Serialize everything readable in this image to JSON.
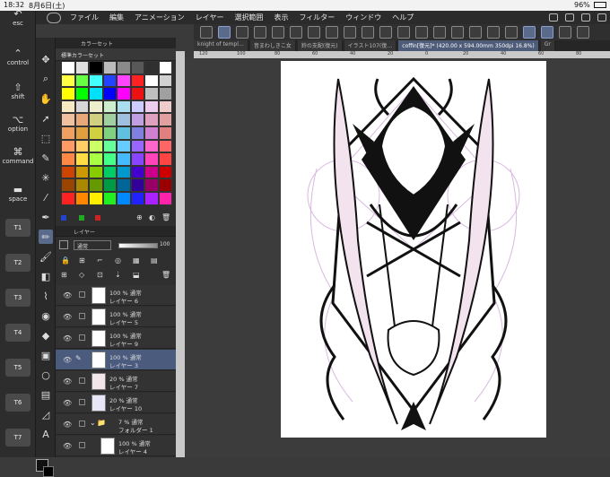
{
  "status": {
    "time": "18:32",
    "date": "8月6日(土)",
    "battery": "96%"
  },
  "menu": [
    "ファイル",
    "編集",
    "アニメーション",
    "レイヤー",
    "選択範囲",
    "表示",
    "フィルター",
    "ウィンドウ",
    "ヘルプ"
  ],
  "keys": {
    "esc": "esc",
    "control": "control",
    "shift": "shift",
    "option": "option",
    "command": "command",
    "space": "space",
    "t": [
      "T1",
      "T2",
      "T3",
      "T4",
      "T5",
      "T6",
      "T7"
    ]
  },
  "tabs": [
    "knight of templ…",
    "音まわしきこ女",
    "鈴の支配(復元)",
    "イラスト107(復…",
    "coffin[復元]* (420.00 x 594.00mm 350dpi 16.8%)",
    "Gr"
  ],
  "color_panel": {
    "title": "カラーセット",
    "set_name": "標準カラーセット",
    "swatches": [
      "#ffffff",
      "#e0e0e0",
      "#000000",
      "#bcbcbc",
      "#8a8a8a",
      "#585858",
      "#303030",
      "#ffffff",
      "#ffff44",
      "#66ff44",
      "#44ffff",
      "#2244ff",
      "#ff44ff",
      "#ff2222",
      "#ffffff",
      "#d0d0d0",
      "#ffff00",
      "#00ff00",
      "#00e0ff",
      "#0000ff",
      "#ff00ff",
      "#ee1111",
      "#c0c0c0",
      "#a0a0a0",
      "#f7e9c4",
      "#d7d7d7",
      "#eeeecc",
      "#cceecc",
      "#aaddee",
      "#ccccff",
      "#eeccee",
      "#eecccc",
      "#f0c0a0",
      "#e8a87a",
      "#d0d080",
      "#a0d0a0",
      "#a0c0e0",
      "#c0a0e0",
      "#e0a0c0",
      "#e0a0a0",
      "#f0a060",
      "#e0a040",
      "#d0d040",
      "#80d080",
      "#60c0e0",
      "#8080e0",
      "#d080d0",
      "#e08080",
      "#ff9966",
      "#ffcc66",
      "#ccff66",
      "#66ff99",
      "#66ccff",
      "#9966ff",
      "#ff66cc",
      "#ff6666",
      "#ff8844",
      "#ffdd44",
      "#aaff44",
      "#44ff88",
      "#44bbff",
      "#8844ff",
      "#ff44bb",
      "#ff4444",
      "#cc4400",
      "#cc9900",
      "#88cc00",
      "#00cc66",
      "#0099cc",
      "#4400cc",
      "#cc0088",
      "#cc0000",
      "#994400",
      "#aa8800",
      "#669900",
      "#009944",
      "#006699",
      "#330099",
      "#990066",
      "#990000",
      "#ff2222",
      "#ff8800",
      "#ffee00",
      "#22ee22",
      "#0088ff",
      "#2222ff",
      "#aa22ff",
      "#ff22aa"
    ]
  },
  "layer_panel": {
    "title": "レイヤー",
    "blend": "通常",
    "opacity": "100",
    "layers": [
      {
        "mode": "100 % 通常",
        "name": "レイヤー 6"
      },
      {
        "mode": "100 % 通常",
        "name": "レイヤー 5"
      },
      {
        "mode": "100 % 通常",
        "name": "レイヤー 9"
      },
      {
        "mode": "100 % 通常",
        "name": "レイヤー 3"
      },
      {
        "mode": "20 % 通常",
        "name": "レイヤー 7"
      },
      {
        "mode": "20 % 通常",
        "name": "レイヤー 10"
      },
      {
        "mode": "7 % 通常",
        "name": "フォルダー 1"
      },
      {
        "mode": "100 % 通常",
        "name": "レイヤー 4"
      }
    ]
  },
  "ruler_ticks": [
    "120",
    "100",
    "80",
    "60",
    "40",
    "20",
    "0",
    "20",
    "40",
    "60",
    "80"
  ]
}
